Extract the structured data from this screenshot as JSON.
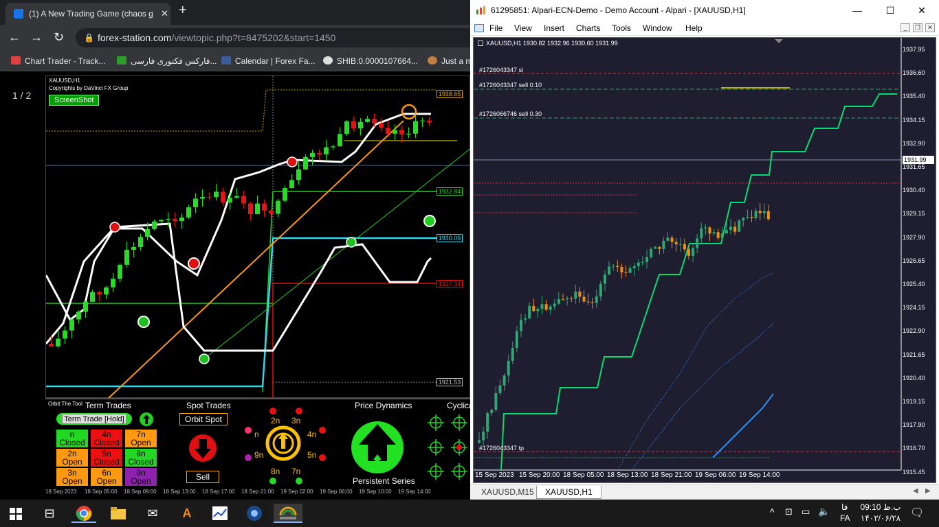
{
  "browser": {
    "tab_title": "(1) A New Trading Game (chaos g",
    "url_host": "forex-station.com",
    "url_path": "/viewtopic.php?t=8475202&start=1450",
    "bookmarks": [
      "Chart Trader - Track...",
      "فارکس فکتوری فارسی...",
      "Calendar | Forex Fa...",
      "SHIB:0.0000107664...",
      "Just a m"
    ],
    "page_counter": "1 / 2"
  },
  "web_chart": {
    "symbol": "XAUUSD,H1",
    "copyright": "Copyrights by DaVinci FX Group",
    "screenshot_button": "ScreenShot",
    "levels": [
      {
        "value": "1938.65",
        "color": "#d8a800"
      },
      {
        "value": "1932.84",
        "color": "#20d020"
      },
      {
        "value": "1930.09",
        "color": "#30d8f0"
      },
      {
        "value": "1927.34",
        "color": "#e01010"
      },
      {
        "value": "1921.53",
        "color": "#bbbbbb"
      }
    ],
    "time_labels": [
      "18 Sep 2023",
      "18 Sep 05:00",
      "18 Sep 09:00",
      "18 Sep 13:00",
      "18 Sep 17:00",
      "18 Sep 21:00",
      "19 Sep 02:00",
      "19 Sep 06:00",
      "19 Sep 10:00",
      "19 Sep 14:00"
    ]
  },
  "panel": {
    "orbit_tool": "Orbit The Tool",
    "term_trades": "Term Trades",
    "term_trade_hold": "Term Trade [Hold]",
    "cells": [
      {
        "l1": "n",
        "l2": "Closed",
        "color": "green"
      },
      {
        "l1": "4n",
        "l2": "Closed",
        "color": "red"
      },
      {
        "l1": "7n",
        "l2": "Open",
        "color": "orange"
      },
      {
        "l1": "2n",
        "l2": "Open",
        "color": "orange"
      },
      {
        "l1": "5n",
        "l2": "Closed",
        "color": "red"
      },
      {
        "l1": "8n",
        "l2": "Closed",
        "color": "green"
      },
      {
        "l1": "3n",
        "l2": "Open",
        "color": "orange"
      },
      {
        "l1": "6n",
        "l2": "Open",
        "color": "orange"
      },
      {
        "l1": "9n",
        "l2": "Open",
        "color": "purple"
      }
    ],
    "spot_trades": "Spot Trades",
    "orbit_spot": "Orbit Spot",
    "sell": "Sell",
    "orbit_labels": {
      "n2": "2n",
      "n3": "3n",
      "n4": "4n",
      "n5": "5n",
      "n7": "7n",
      "n8": "8n",
      "n9": "9n",
      "n1": "n"
    },
    "price_dynamics": "Price Dynamics",
    "persistent_series": "Persistent Series",
    "cyclical": "Cyclica"
  },
  "mt4": {
    "window_title": "61295851: Alpari-ECN-Demo - Demo Account - Alpari - [XAUUSD,H1]",
    "menu": [
      "File",
      "View",
      "Insert",
      "Charts",
      "Tools",
      "Window",
      "Help"
    ],
    "chart_header": "XAUUSD,H1  1930.82 1932.96 1930.60 1931.99",
    "orders": {
      "o1": "#1726043347 sl",
      "o2": "#1726043347 sell 0.10",
      "o3": "#1726066746 sell 0.30",
      "o4": "#1726043347 tp"
    },
    "price_ticks": [
      "1937.95",
      "1936.60",
      "1935.40",
      "1934.15",
      "1932.90",
      "1931.65",
      "1930.40",
      "1929.15",
      "1927.90",
      "1926.65",
      "1925.40",
      "1924.15",
      "1922.90",
      "1921.65",
      "1920.40",
      "1919.15",
      "1917.90",
      "1916.70",
      "1915.45"
    ],
    "current_price": "1931.99",
    "time_labels": [
      "15 Sep 2023",
      "15 Sep 20:00",
      "18 Sep 05:00",
      "18 Sep 13:00",
      "18 Sep 21:00",
      "19 Sep 06:00",
      "19 Sep 14:00"
    ],
    "tabs": [
      "XAUUSD,M15",
      "XAUUSD,H1"
    ]
  },
  "taskbar": {
    "clock_time": "09:10 ب.ظ",
    "clock_date": "۱۴۰۲/۰۶/۲۸",
    "lang": "FA",
    "lang2": "فا"
  }
}
